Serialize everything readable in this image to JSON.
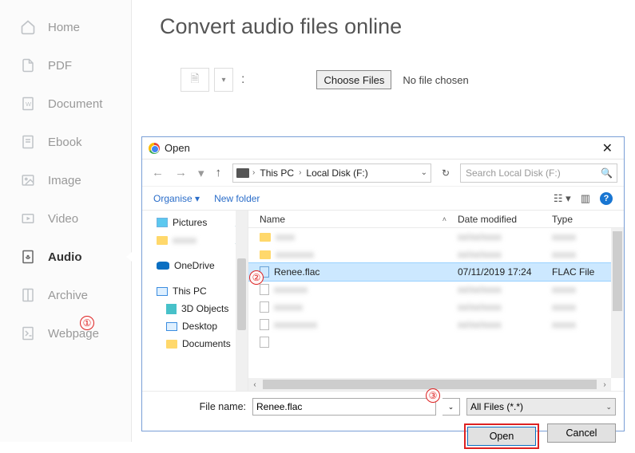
{
  "sidebar": {
    "items": [
      {
        "label": "Home"
      },
      {
        "label": "PDF"
      },
      {
        "label": "Document"
      },
      {
        "label": "Ebook"
      },
      {
        "label": "Image"
      },
      {
        "label": "Video"
      },
      {
        "label": "Audio"
      },
      {
        "label": "Archive"
      },
      {
        "label": "Webpage"
      }
    ]
  },
  "page": {
    "title": "Convert audio files online",
    "choose_label": "Choose Files",
    "no_file": "No file chosen",
    "colon": ":"
  },
  "dialog": {
    "title": "Open",
    "breadcrumb": {
      "pc": "This PC",
      "drive": "Local Disk (F:)"
    },
    "search_placeholder": "Search Local Disk (F:)",
    "toolbar": {
      "organise": "Organise ▾",
      "newfolder": "New folder"
    },
    "columns": {
      "name": "Name",
      "date": "Date modified",
      "type": "Type"
    },
    "tree": {
      "pictures": "Pictures",
      "onedrive": "OneDrive",
      "thispc": "This PC",
      "3d": "3D Objects",
      "desktop": "Desktop",
      "documents": "Documents"
    },
    "files": {
      "selected_name": "Renee.flac",
      "selected_date": "07/11/2019 17:24",
      "selected_type": "FLAC File"
    },
    "footer": {
      "fn_label": "File name:",
      "fn_value": "Renee.flac",
      "filter": "All Files (*.*)",
      "open": "Open",
      "cancel": "Cancel"
    }
  },
  "annotations": {
    "a1": "①",
    "a2": "②",
    "a3": "③"
  }
}
